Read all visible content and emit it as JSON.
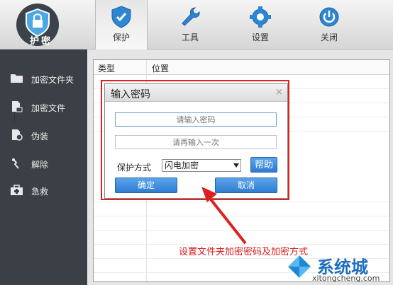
{
  "app": {
    "logo_text": "护密",
    "accent": "#2f7cd1",
    "annotation_color": "#e02020"
  },
  "toolbar": {
    "tabs": [
      {
        "label": "保护",
        "icon": "shield-icon",
        "active": true
      },
      {
        "label": "工具",
        "icon": "wrench-icon",
        "active": false
      },
      {
        "label": "设置",
        "icon": "gear-icon",
        "active": false
      },
      {
        "label": "关闭",
        "icon": "power-icon",
        "active": false
      }
    ]
  },
  "sidebar": {
    "items": [
      {
        "label": "加密文件夹",
        "icon": "folder-icon"
      },
      {
        "label": "加密文件",
        "icon": "file-lock-icon"
      },
      {
        "label": "伪装",
        "icon": "disguise-icon"
      },
      {
        "label": "解除",
        "icon": "unlock-icon"
      },
      {
        "label": "急救",
        "icon": "first-aid-icon"
      }
    ]
  },
  "list": {
    "columns": [
      "类型",
      "位置"
    ]
  },
  "dialog": {
    "title": "输入密码",
    "close": "×",
    "password_placeholder": "请输入密码",
    "confirm_placeholder": "请再输入一次",
    "mode_label": "保护方式",
    "mode_value": "闪电加密",
    "help_label": "帮助",
    "ok_label": "确定",
    "cancel_label": "取消"
  },
  "annotation": {
    "text": "设置文件夹加密密码及加密方式"
  },
  "watermark": {
    "brand": "系统城",
    "url": "xitongcheng.com"
  }
}
